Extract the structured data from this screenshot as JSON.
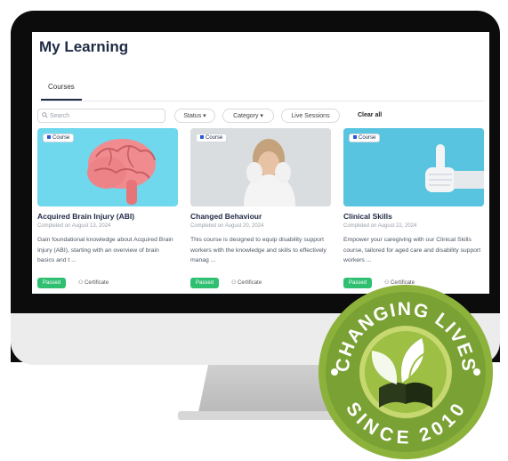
{
  "page": {
    "title": "My Learning"
  },
  "tabs": [
    {
      "label": "Courses"
    }
  ],
  "filters": {
    "search_placeholder": "Search",
    "status_label": "Status ▾",
    "category_label": "Category ▾",
    "live_sessions_label": "Live Sessions",
    "clear_all_label": "Clear all"
  },
  "courses": [
    {
      "type_label": "Course",
      "title": "Acquired Brain Injury (ABI)",
      "completed": "Completed on August 13, 2024",
      "description": "Gain foundational knowledge about Acquired Brain Injury (ABI), starting with an overview of brain basics and t ...",
      "status": "Passed",
      "certificate": "Certificate"
    },
    {
      "type_label": "Course",
      "title": "Changed Behaviour",
      "completed": "Completed on August 20, 2024",
      "description": "This course is designed to equip disability support workers with the knowledge and skills to effectively manag ...",
      "status": "Passed",
      "certificate": "Certificate"
    },
    {
      "type_label": "Course",
      "title": "Clinical Skills",
      "completed": "Completed on August 22, 2024",
      "description": "Empower your caregiving with our Clinical Skills course, tailored for aged care and disability support workers ...",
      "status": "Passed",
      "certificate": "Certificate"
    }
  ],
  "badge": {
    "top_text": "CHANGING LIVES",
    "bottom_text": "SINCE 2010"
  }
}
